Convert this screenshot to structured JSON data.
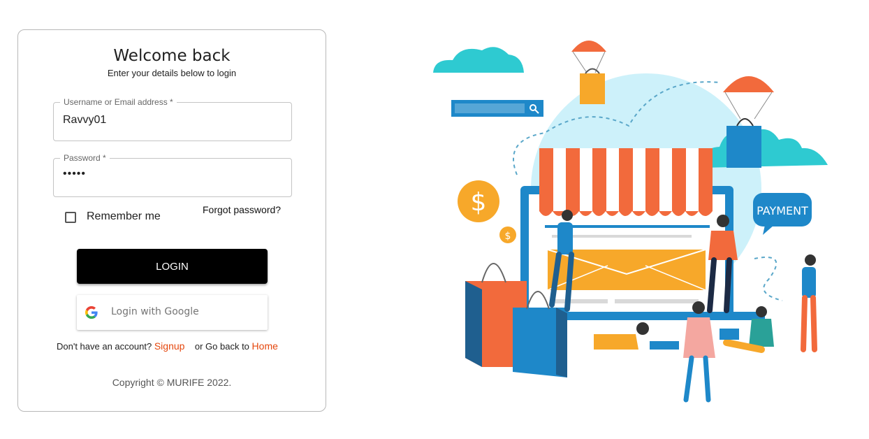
{
  "login": {
    "title": "Welcome back",
    "subtitle": "Enter your details below to login",
    "username_label": "Username or Email address *",
    "username_value": "Ravvy01",
    "password_label": "Password *",
    "password_mask": "•••••",
    "remember_label": "Remember me",
    "remember_checked": false,
    "forgot_label": "Forgot password?",
    "login_button": "LOGIN",
    "google_button": "Login with Google",
    "no_account_text": "Don't have an account?",
    "signup_link": "Signup",
    "go_back_text": "or Go back to",
    "home_link": "Home",
    "copyright": "Copyright © MURIFE 2022."
  },
  "illustration": {
    "payment_label": "PAYMENT",
    "dollar_symbol": "$",
    "icons": [
      "google-g-icon",
      "shopping-bag-icon",
      "dollar-coin-icon",
      "search-icon",
      "parachute-icon",
      "cloud-icon"
    ]
  },
  "colors": {
    "login_bg": "#000000",
    "link": "#e5470d",
    "awning_red": "#f26a3c",
    "shop_blue": "#1e88c9",
    "envelope_yellow": "#f7a82a",
    "cloud_teal": "#2ecad1"
  }
}
